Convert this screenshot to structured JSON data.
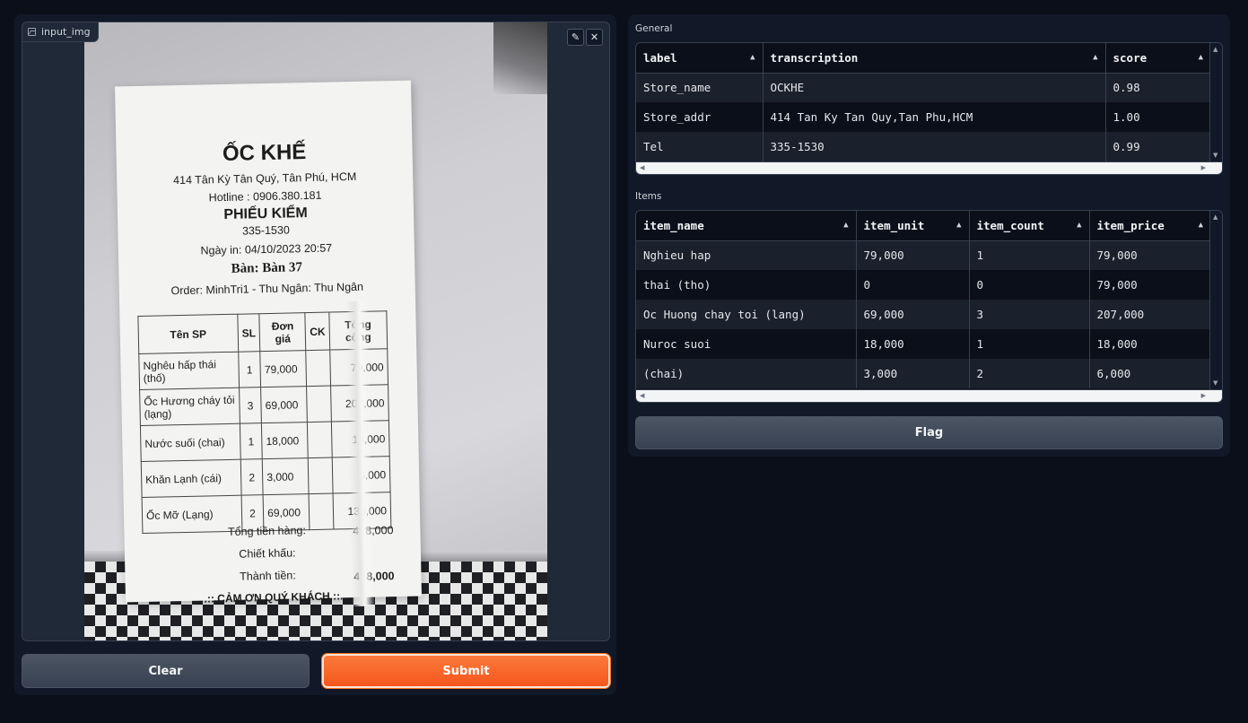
{
  "image_input": {
    "label": "input_img",
    "edit_icon": "pencil-icon",
    "close_icon": "close-icon"
  },
  "receipt": {
    "store": "ỐC KHẾ",
    "address": "414 Tân Kỳ Tân Quý, Tân Phú, HCM",
    "hotline": "Hotline : 0906.380.181",
    "title": "PHIẾU KIỂM",
    "code": "335-1530",
    "date": "Ngày in: 04/10/2023 20:57",
    "table": "Bàn: Bàn 37",
    "order": "Order: MinhTri1 - Thu Ngân: Thu Ngân",
    "headers": [
      "Tên SP",
      "SL",
      "Đơn giá",
      "CK",
      "Tổng cộng"
    ],
    "rows": [
      {
        "name": "Nghêu hấp thái (thố)",
        "qty": "1",
        "price": "79,000",
        "ck": "",
        "total": "79,000"
      },
      {
        "name": "Ốc Hương cháy tỏi (lạng)",
        "qty": "3",
        "price": "69,000",
        "ck": "",
        "total": "207,000"
      },
      {
        "name": "Nước suối (chai)",
        "qty": "1",
        "price": "18,000",
        "ck": "",
        "total": "18,000"
      },
      {
        "name": "Khăn Lạnh (cái)",
        "qty": "2",
        "price": "3,000",
        "ck": "",
        "total": "6,000"
      },
      {
        "name": "Ốc Mỡ (Lạng)",
        "qty": "2",
        "price": "69,000",
        "ck": "",
        "total": "138,000"
      }
    ],
    "subtotal_label": "Tổng tiền hàng:",
    "subtotal": "448,000",
    "discount_label": "Chiết khấu:",
    "grand_label": "Thành tiền:",
    "grand_total": "448,000",
    "thanks": ".:: CẢM ƠN QUÝ KHÁCH ::."
  },
  "buttons": {
    "clear": "Clear",
    "submit": "Submit",
    "flag": "Flag"
  },
  "general": {
    "label": "General",
    "columns": [
      "label",
      "transcription",
      "score"
    ],
    "rows": [
      [
        "Store_name",
        "OCKHE",
        "0.98"
      ],
      [
        "Store_addr",
        "414 Tan Ky Tan Quy,Tan Phu,HCM",
        "1.00"
      ],
      [
        "Tel",
        "335-1530",
        "0.99"
      ]
    ]
  },
  "items": {
    "label": "Items",
    "columns": [
      "item_name",
      "item_unit",
      "item_count",
      "item_price"
    ],
    "rows": [
      [
        "Nghieu hap",
        "79,000",
        "1",
        "79,000"
      ],
      [
        "thai (tho)",
        "0",
        "0",
        "79,000"
      ],
      [
        "Oc Huong chay toi (lang)",
        "69,000",
        "3",
        "207,000"
      ],
      [
        "Nuroc suoi",
        "18,000",
        "1",
        "18,000"
      ],
      [
        "(chai)",
        "3,000",
        "2",
        "6,000"
      ]
    ]
  }
}
